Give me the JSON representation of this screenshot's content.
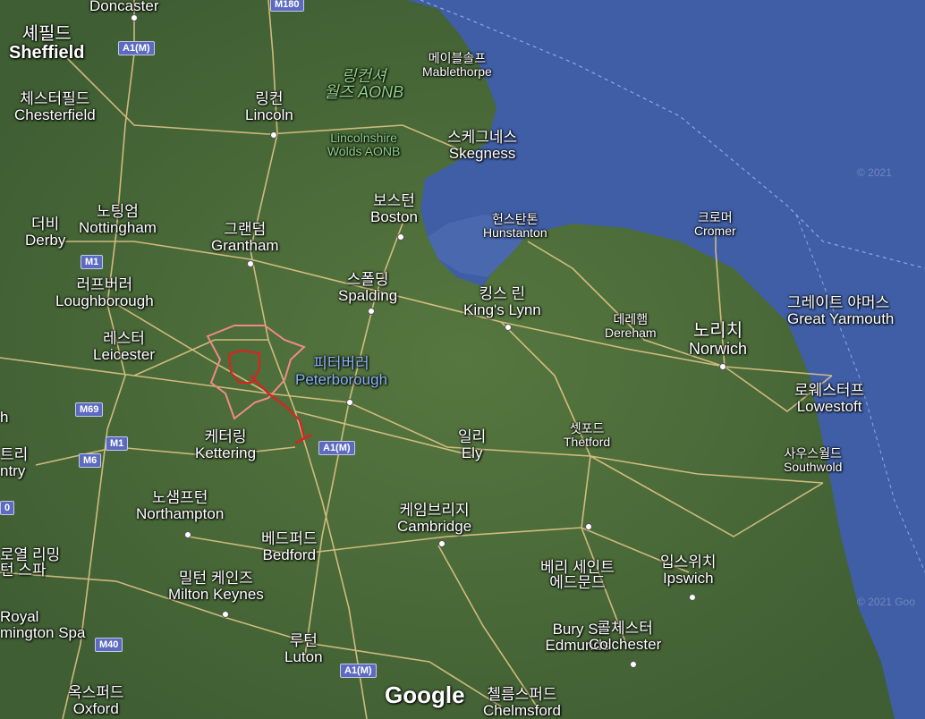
{
  "map": {
    "style": "satellite",
    "colors": {
      "sea": "#3f5ea6",
      "land": "#4a6a3a",
      "road": "#e8c98a",
      "motorway": "#f3d47e",
      "boundary": "#e0453f",
      "route": "#e02020",
      "label_highlight": "#8ab4f8"
    },
    "cities": [
      {
        "id": "doncaster",
        "en": "Doncaster",
        "ko": ""
      },
      {
        "id": "sheffield",
        "en": "Sheffield",
        "ko": "셰필드"
      },
      {
        "id": "chesterfield",
        "en": "Chesterfield",
        "ko": "체스터필드"
      },
      {
        "id": "lincoln",
        "en": "Lincoln",
        "ko": "링컨"
      },
      {
        "id": "mablethorpe",
        "en": "Mablethorpe",
        "ko": "메이블솔프"
      },
      {
        "id": "skegness",
        "en": "Skegness",
        "ko": "스케그네스"
      },
      {
        "id": "boston",
        "en": "Boston",
        "ko": "보스턴"
      },
      {
        "id": "nottingham",
        "en": "Nottingham",
        "ko": "노팅엄"
      },
      {
        "id": "derby",
        "en": "Derby",
        "ko": "더비"
      },
      {
        "id": "grantham",
        "en": "Grantham",
        "ko": "그랜덤"
      },
      {
        "id": "hunstanton",
        "en": "Hunstanton",
        "ko": "헌스탄톤"
      },
      {
        "id": "cromer",
        "en": "Cromer",
        "ko": "크로머"
      },
      {
        "id": "spalding",
        "en": "Spalding",
        "ko": "스폴딩"
      },
      {
        "id": "loughborough",
        "en": "Loughborough",
        "ko": "러프버러"
      },
      {
        "id": "kings_lynn",
        "en": "King's Lynn",
        "ko": "킹스 린"
      },
      {
        "id": "dereham",
        "en": "Dereham",
        "ko": "데레햄"
      },
      {
        "id": "norwich",
        "en": "Norwich",
        "ko": "노리치"
      },
      {
        "id": "great_yarmouth",
        "en": "Great Yarmouth",
        "ko": "그레이트 야머스"
      },
      {
        "id": "leicester",
        "en": "Leicester",
        "ko": "레스터"
      },
      {
        "id": "peterborough",
        "en": "Peterborough",
        "ko": "피터버러"
      },
      {
        "id": "lowestoft",
        "en": "Lowestoft",
        "ko": "로웨스터프"
      },
      {
        "id": "kettering",
        "en": "Kettering",
        "ko": "케터링"
      },
      {
        "id": "ely",
        "en": "Ely",
        "ko": "일리"
      },
      {
        "id": "thetford",
        "en": "Thetford",
        "ko": "셋포드"
      },
      {
        "id": "southwold",
        "en": "Southwold",
        "ko": "사우스월드"
      },
      {
        "id": "northampton",
        "en": "Northampton",
        "ko": "노샘프턴"
      },
      {
        "id": "cambridge",
        "en": "Cambridge",
        "ko": "케임브리지"
      },
      {
        "id": "royal_leamington",
        "en": "Royal\nmington Spa",
        "ko": "로열 리밍\n턴 스파"
      },
      {
        "id": "bedford",
        "en": "Bedford",
        "ko": "베드퍼드"
      },
      {
        "id": "bury_st_edmunds",
        "en": "Bury St\nEdmunds",
        "ko": "베리 세인트\n에드문드"
      },
      {
        "id": "ipswich",
        "en": "Ipswich",
        "ko": "입스위치"
      },
      {
        "id": "milton_keynes",
        "en": "Milton Keynes",
        "ko": "밀턴 케인즈"
      },
      {
        "id": "colchester",
        "en": "Colchester",
        "ko": "콜체스터"
      },
      {
        "id": "luton",
        "en": "Luton",
        "ko": "루턴"
      },
      {
        "id": "oxford",
        "en": "Oxford",
        "ko": "옥스퍼드"
      },
      {
        "id": "chelmsford",
        "en": "Chelmsford",
        "ko": "첼름스퍼드"
      },
      {
        "id": "coventry",
        "en": "ntry",
        "ko": "트리"
      },
      {
        "id": "edge_h",
        "en": "",
        "ko": "h"
      }
    ],
    "park": {
      "en": "Lincolnshire\nWolds AONB",
      "ko": "링컨셔\n월즈 AONB"
    },
    "road_shields": [
      "M180",
      "A1(M)",
      "M1",
      "M69",
      "M1",
      "M6",
      "A1(M)",
      "M40",
      "A1(M)",
      "0"
    ],
    "logo": "Google",
    "copyright": [
      "© 2021",
      "© 2021 Goo"
    ]
  }
}
